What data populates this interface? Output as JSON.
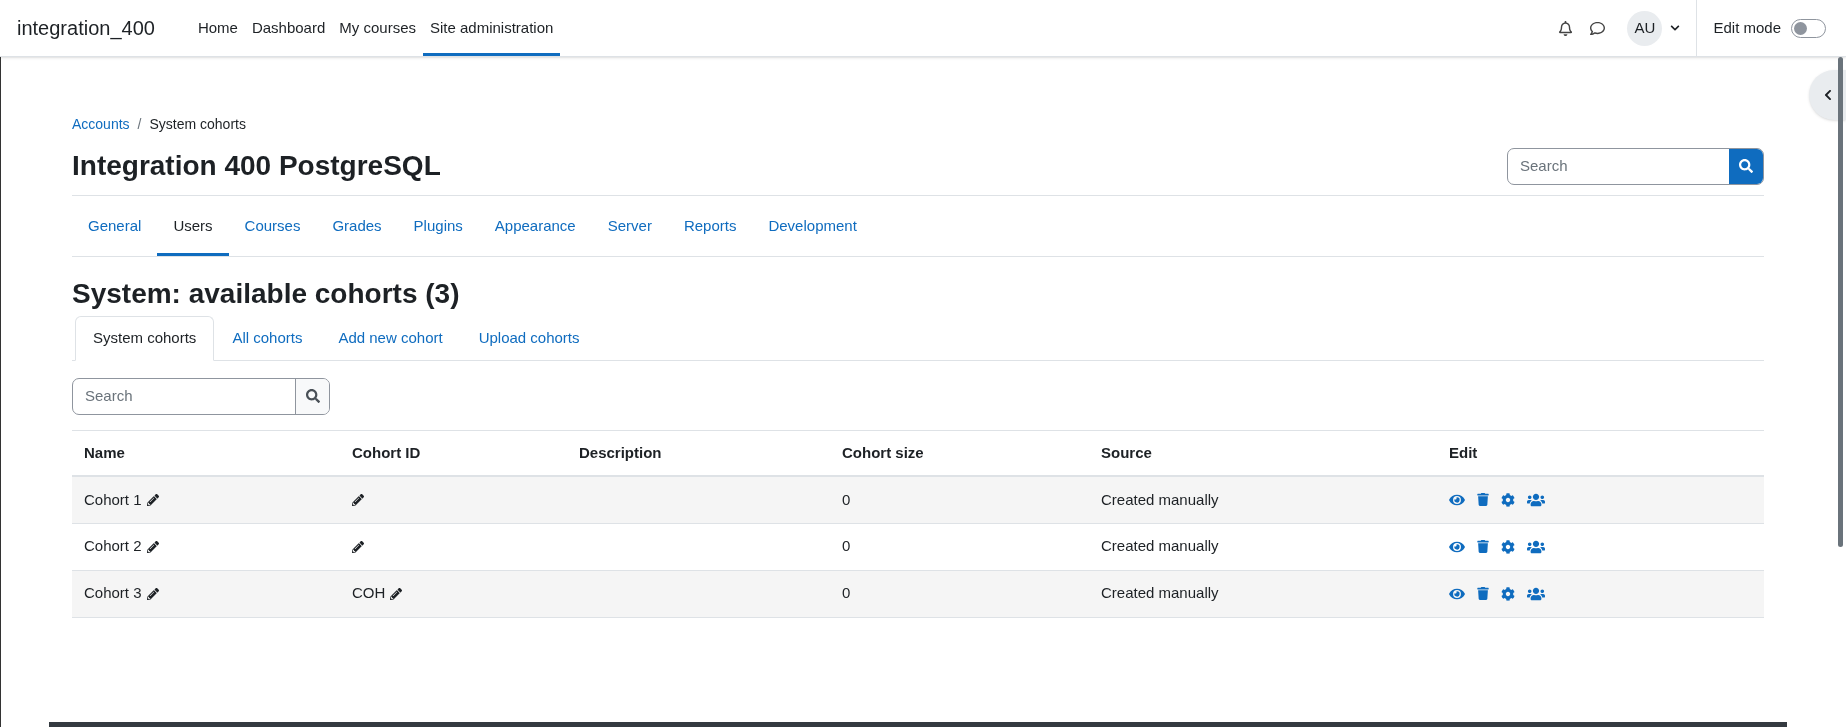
{
  "navbar": {
    "brand": "integration_400",
    "items": [
      {
        "label": "Home",
        "selected": false
      },
      {
        "label": "Dashboard",
        "selected": false
      },
      {
        "label": "My courses",
        "selected": false
      },
      {
        "label": "Site administration",
        "selected": true
      }
    ],
    "avatar": "AU",
    "edit_mode": {
      "label": "Edit mode",
      "on": false
    }
  },
  "breadcrumb_separator": "/",
  "breadcrumb": [
    {
      "label": "Accounts",
      "link": true
    },
    {
      "label": "System cohorts",
      "link": false
    }
  ],
  "page_title": "Integration 400 PostgreSQL",
  "header_search": {
    "placeholder": "Search"
  },
  "admin_tabs": [
    {
      "label": "General",
      "selected": false
    },
    {
      "label": "Users",
      "selected": true
    },
    {
      "label": "Courses",
      "selected": false
    },
    {
      "label": "Grades",
      "selected": false
    },
    {
      "label": "Plugins",
      "selected": false
    },
    {
      "label": "Appearance",
      "selected": false
    },
    {
      "label": "Server",
      "selected": false
    },
    {
      "label": "Reports",
      "selected": false
    },
    {
      "label": "Development",
      "selected": false
    }
  ],
  "heading": "System: available cohorts (3)",
  "cohort_tabs": [
    {
      "label": "System cohorts",
      "selected": true
    },
    {
      "label": "All cohorts",
      "selected": false
    },
    {
      "label": "Add new cohort",
      "selected": false
    },
    {
      "label": "Upload cohorts",
      "selected": false
    }
  ],
  "cohort_search": {
    "placeholder": "Search"
  },
  "table": {
    "columns": [
      "Name",
      "Cohort ID",
      "Description",
      "Cohort size",
      "Source",
      "Edit"
    ],
    "rows": [
      {
        "name": "Cohort 1",
        "cohort_id": "",
        "size": "0",
        "source": "Created manually"
      },
      {
        "name": "Cohort 2",
        "cohort_id": "",
        "size": "0",
        "source": "Created manually"
      },
      {
        "name": "Cohort 3",
        "cohort_id": "COH",
        "size": "0",
        "source": "Created manually"
      }
    ]
  }
}
